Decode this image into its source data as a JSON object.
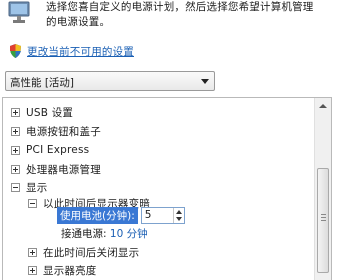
{
  "intro": {
    "line1": "选择您喜自定义的电源计划，然后选择您希望计算机管理",
    "line2": "的电源设置。"
  },
  "change_link": "更改当前不可用的设置",
  "plan_select": {
    "value": "高性能 [活动]"
  },
  "tree": {
    "items": [
      {
        "label": "USB 设置"
      },
      {
        "label": "电源按钮和盖子"
      },
      {
        "label": "PCI Express"
      },
      {
        "label": "处理器电源管理"
      },
      {
        "label": "显示"
      }
    ],
    "display_children": {
      "dim": {
        "label": "以此时间后显示器变暗"
      },
      "setting_label": "使用电池(分钟):",
      "setting_value": "5",
      "plugged_label": "接通电源:",
      "plugged_value": "10 分钟",
      "off": {
        "label": "在此时间后关闭显示"
      },
      "brightness": {
        "label": "显示器亮度"
      }
    }
  },
  "colors": {
    "link": "#1a5fb4",
    "selection": "#3a78d4"
  }
}
